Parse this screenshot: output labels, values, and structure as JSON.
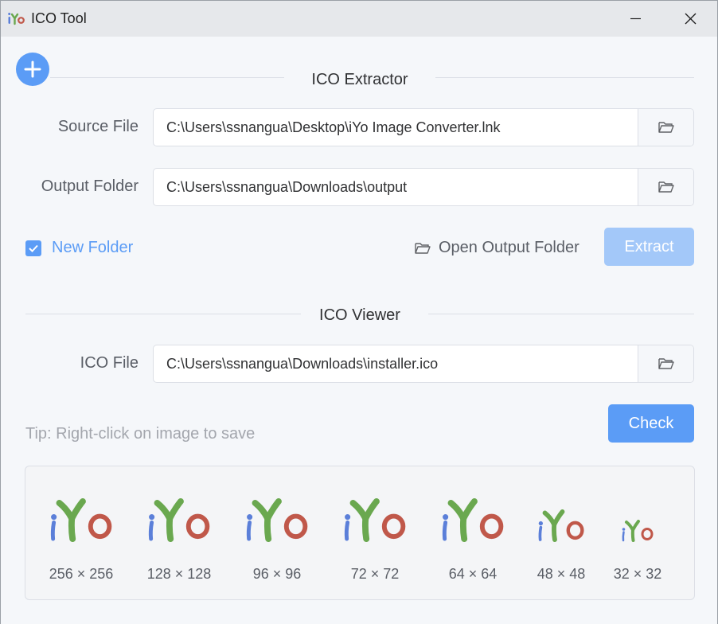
{
  "window": {
    "title": "ICO Tool",
    "logo_text": "iYo"
  },
  "extractor": {
    "section_title": "ICO Extractor",
    "source_label": "Source File",
    "source_value": "C:\\Users\\ssnangua\\Desktop\\iYo Image Converter.lnk",
    "output_label": "Output Folder",
    "output_value": "C:\\Users\\ssnangua\\Downloads\\output",
    "new_folder_label": "New Folder",
    "new_folder_checked": true,
    "open_output_label": "Open Output Folder",
    "extract_label": "Extract"
  },
  "viewer": {
    "section_title": "ICO Viewer",
    "ico_label": "ICO File",
    "ico_value": "C:\\Users\\ssnangua\\Downloads\\installer.ico",
    "tip": "Tip: Right-click on image to save",
    "check_label": "Check",
    "icons": [
      {
        "caption": "256 × 256",
        "logo_text": "iYo"
      },
      {
        "caption": "128 × 128",
        "logo_text": "iYo"
      },
      {
        "caption": "96 × 96",
        "logo_text": "iYo"
      },
      {
        "caption": "72 × 72",
        "logo_text": "iYo"
      },
      {
        "caption": "64 × 64",
        "logo_text": "iYo"
      },
      {
        "caption": "48 × 48",
        "logo_text": "iYo"
      },
      {
        "caption": "32 × 32",
        "logo_text": "iYo"
      }
    ]
  },
  "colors": {
    "primary": "#5b9cf6",
    "primary_disabled": "#a3c8f9",
    "logo_blue": "#5b7fd9",
    "logo_green": "#6aa84f",
    "logo_red": "#c0584a"
  }
}
